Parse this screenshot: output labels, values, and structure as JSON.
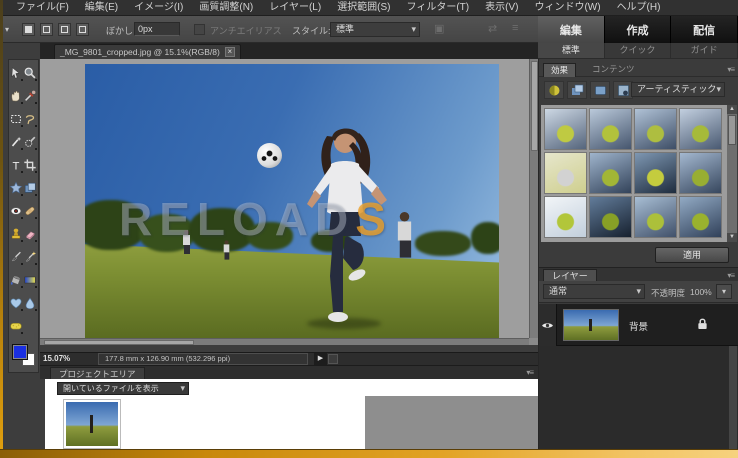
{
  "menu_bar": {
    "items": [
      "ファイル(F)",
      "編集(E)",
      "イメージ(I)",
      "画質調整(N)",
      "レイヤー(L)",
      "選択範囲(S)",
      "フィルター(T)",
      "表示(V)",
      "ウィンドウ(W)",
      "ヘルプ(H)"
    ]
  },
  "options_bar": {
    "feather_label": "ぼかし",
    "feather_value": "0px",
    "antialias_label": "アンチエイリアス",
    "style_label": "スタイル:",
    "style_value": "標準"
  },
  "workspace_tabs": {
    "edit": "編集",
    "create": "作成",
    "share": "配信"
  },
  "mode_tabs": {
    "standard": "標準",
    "quick": "クイック",
    "guided": "ガイド"
  },
  "document": {
    "tab_title": "_MG_9801_cropped.jpg @ 15.1%(RGB/8)",
    "close_glyph": "×",
    "zoom_level": "15.07%",
    "dimensions": "177.8 mm x 126.90 mm (532.296 ppi)",
    "watermark": "RELOADS"
  },
  "toolbar": {
    "tools": [
      "move",
      "zoom",
      "hand",
      "eyedropper",
      "marquee",
      "lasso",
      "magic-wand",
      "quick-selection",
      "type",
      "crop",
      "cookie-cutter",
      "recompose",
      "red-eye",
      "healing-brush",
      "clone-stamp",
      "eraser",
      "brush",
      "smart-brush",
      "paint-bucket",
      "gradient",
      "heart-shape",
      "blur",
      "sponge"
    ],
    "foreground_color": "#1a2fe0",
    "background_color": "#ffffff"
  },
  "effects_panel": {
    "tab_effects": "効果",
    "tab_content": "コンテンツ",
    "category_value": "アーティスティック",
    "apply_button": "適用",
    "thumbnails": [
      {
        "top": "#cdd8e4",
        "bottom": "#55657c",
        "ball": "#bfca42"
      },
      {
        "top": "#bac9da",
        "bottom": "#46566e",
        "ball": "#b2c23c"
      },
      {
        "top": "#b0c2d6",
        "bottom": "#3e4e66",
        "ball": "#aebe40"
      },
      {
        "top": "#c2cfdf",
        "bottom": "#4a5a72",
        "ball": "#a6ba3a"
      },
      {
        "top": "#e6e6cc",
        "bottom": "#cfcf8e",
        "ball": "#d2d2d2"
      },
      {
        "top": "#9fb4cc",
        "bottom": "#33435a",
        "ball": "#a2b636"
      },
      {
        "top": "#7e97b2",
        "bottom": "#1e2c3e",
        "ball": "#c4cc3e"
      },
      {
        "top": "#a4b8d0",
        "bottom": "#37475e",
        "ball": "#98ae32"
      },
      {
        "top": "#f2f5f8",
        "bottom": "#c2cfdc",
        "ball": "#b2c63a"
      },
      {
        "top": "#627c9a",
        "bottom": "#17212f",
        "ball": "#88a026"
      },
      {
        "top": "#a8bed4",
        "bottom": "#41516a",
        "ball": "#acc03a"
      },
      {
        "top": "#92aac4",
        "bottom": "#31415a",
        "ball": "#9ab22e"
      }
    ]
  },
  "layers_panel": {
    "title": "レイヤー",
    "blend_mode": "通常",
    "opacity_label": "不透明度",
    "opacity_value": "100%",
    "layer_name": "背景"
  },
  "project_area": {
    "title": "プロジェクトエリア",
    "dropdown_value": "開いているファイルを表示"
  },
  "colors": {
    "accent_orange": "#e2a00e"
  }
}
